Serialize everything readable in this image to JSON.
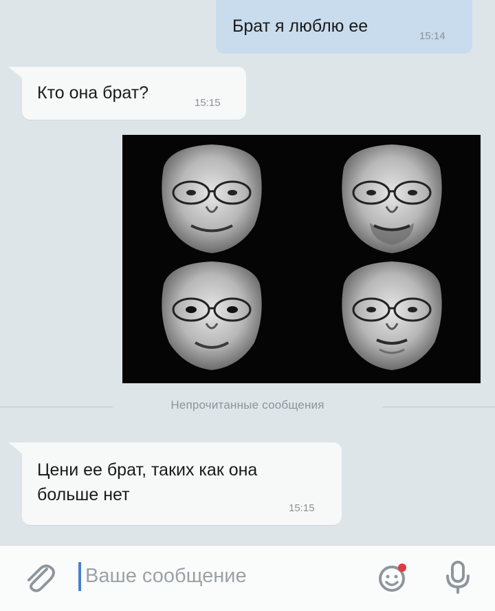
{
  "messages": [
    {
      "direction": "outgoing",
      "text_lines": [
        "Брат я люблю ее"
      ],
      "time": "15:14"
    },
    {
      "direction": "incoming",
      "text_lines": [
        "Кто она брат?"
      ],
      "time": "15:15"
    },
    {
      "direction": "outgoing",
      "type": "photo",
      "photo_desc": "four-faces-collage"
    },
    {
      "direction": "incoming",
      "text_lines": [
        "Цени ее брат, таких как она",
        "больше нет"
      ],
      "time": "15:15"
    }
  ],
  "unread_divider": "Непрочитанные сообщения",
  "composer": {
    "placeholder": "Ваше сообщение",
    "icons": [
      "paperclip-icon",
      "emoji-icon",
      "microphone-icon"
    ]
  },
  "colors": {
    "chat_background": "#dde5e8",
    "outgoing_bubble": "#c9dced",
    "incoming_bubble": "#f7f8f8",
    "accent": "#4a7fcf",
    "notification_dot": "#e0393e"
  }
}
